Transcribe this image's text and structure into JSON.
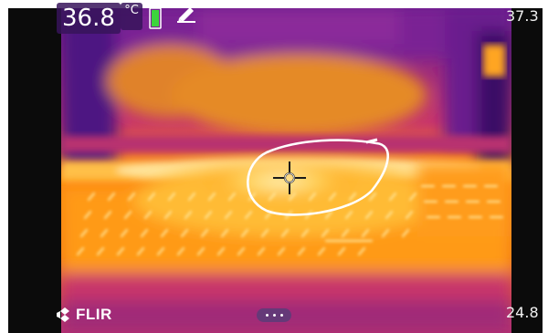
{
  "readout": {
    "temperature": "36.8",
    "unit": "°C"
  },
  "status": {
    "battery_icon": "battery-icon",
    "edit_icon": "pencil-icon",
    "battery_color": "#3cd43c"
  },
  "scale": {
    "max": "37.3",
    "min": "24.8"
  },
  "measurement": {
    "spot_icon": "crosshair-icon",
    "area_icon": "ellipse-marker"
  },
  "brand": {
    "logo_text": "FLIR"
  },
  "menu": {
    "more_icon": "more-dots-icon"
  },
  "palette": {
    "hot": "#ffe8a0",
    "warm": "#ff8c00",
    "mid": "#d2305a",
    "cool": "#7a1a8e",
    "cold": "#3a0f66"
  }
}
